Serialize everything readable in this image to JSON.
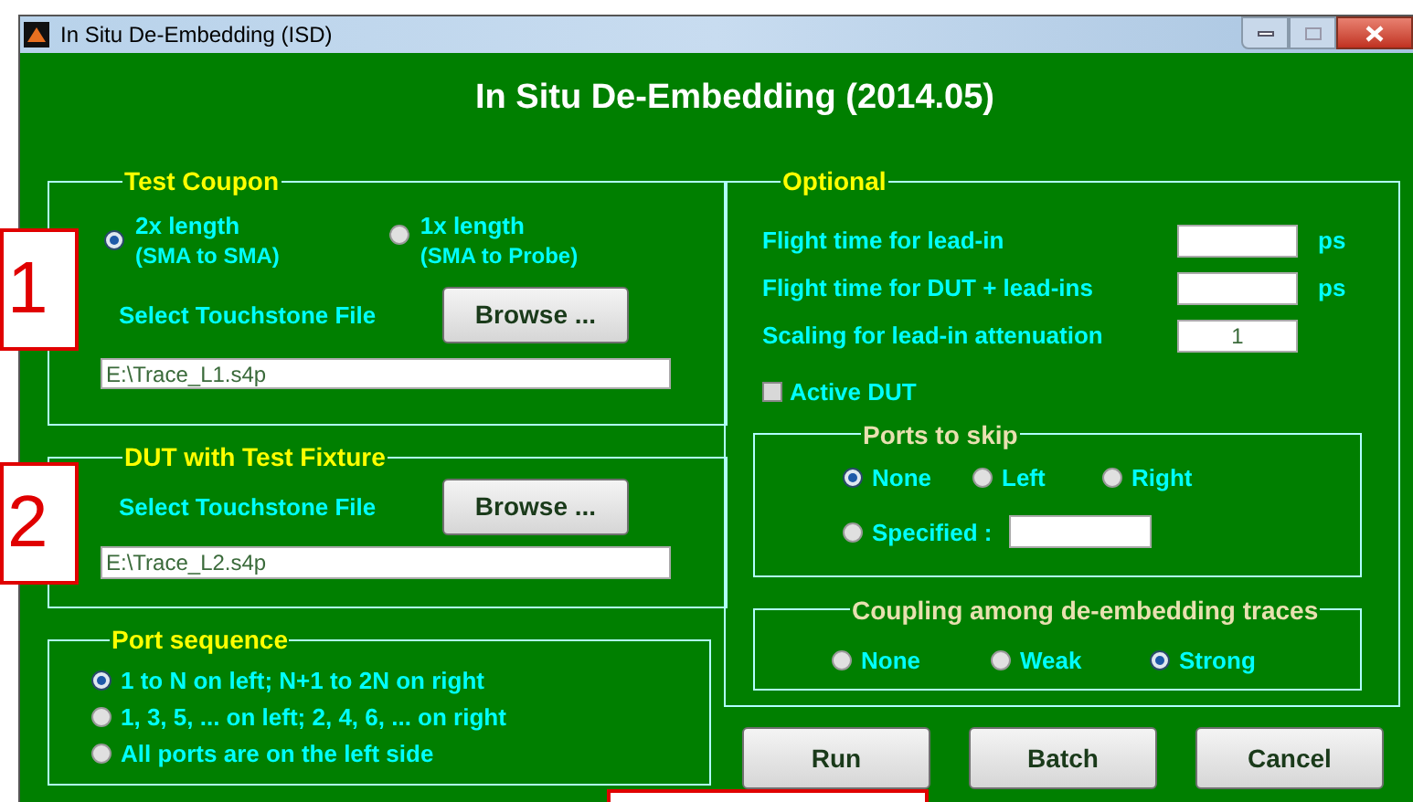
{
  "window": {
    "title": "In Situ De-Embedding (ISD)"
  },
  "heading": "In Situ De-Embedding (2014.05)",
  "test_coupon": {
    "title": "Test Coupon",
    "options": [
      {
        "label": "2x length",
        "sublabel": "(SMA to SMA)",
        "selected": true
      },
      {
        "label": "1x length",
        "sublabel": "(SMA to Probe)",
        "selected": false
      }
    ],
    "file_label": "Select Touchstone File",
    "browse": "Browse ...",
    "file": "E:\\Trace_L1.s4p"
  },
  "dut": {
    "title": "DUT with Test Fixture",
    "file_label": "Select Touchstone File",
    "browse": "Browse ...",
    "file": "E:\\Trace_L2.s4p"
  },
  "port_sequence": {
    "title": "Port sequence",
    "options": [
      {
        "label": "1 to N on left; N+1 to 2N on right",
        "selected": true
      },
      {
        "label": "1, 3, 5, ... on left; 2, 4, 6, ... on right",
        "selected": false
      },
      {
        "label": "All ports are on the left side",
        "selected": false
      }
    ]
  },
  "optional": {
    "title": "Optional",
    "fields": [
      {
        "label": "Flight time for lead-in",
        "unit": "ps"
      },
      {
        "label": "Flight time for DUT + lead-ins",
        "unit": "ps"
      },
      {
        "label": "Scaling for lead-in attenuation",
        "value": "1"
      }
    ],
    "active_dut": {
      "label": "Active DUT",
      "checked": false
    },
    "ports_to_skip": {
      "title": "Ports to skip",
      "options": [
        {
          "label": "None",
          "selected": true
        },
        {
          "label": "Left",
          "selected": false
        },
        {
          "label": "Right",
          "selected": false
        }
      ],
      "specified": {
        "label": "Specified :",
        "selected": false
      }
    },
    "coupling": {
      "title": "Coupling among de-embedding traces",
      "options": [
        {
          "label": "None",
          "selected": false
        },
        {
          "label": "Weak",
          "selected": false
        },
        {
          "label": "Strong",
          "selected": true
        }
      ]
    }
  },
  "buttons": [
    "Run",
    "Batch",
    "Cancel"
  ],
  "annotations": [
    "1",
    "2"
  ]
}
